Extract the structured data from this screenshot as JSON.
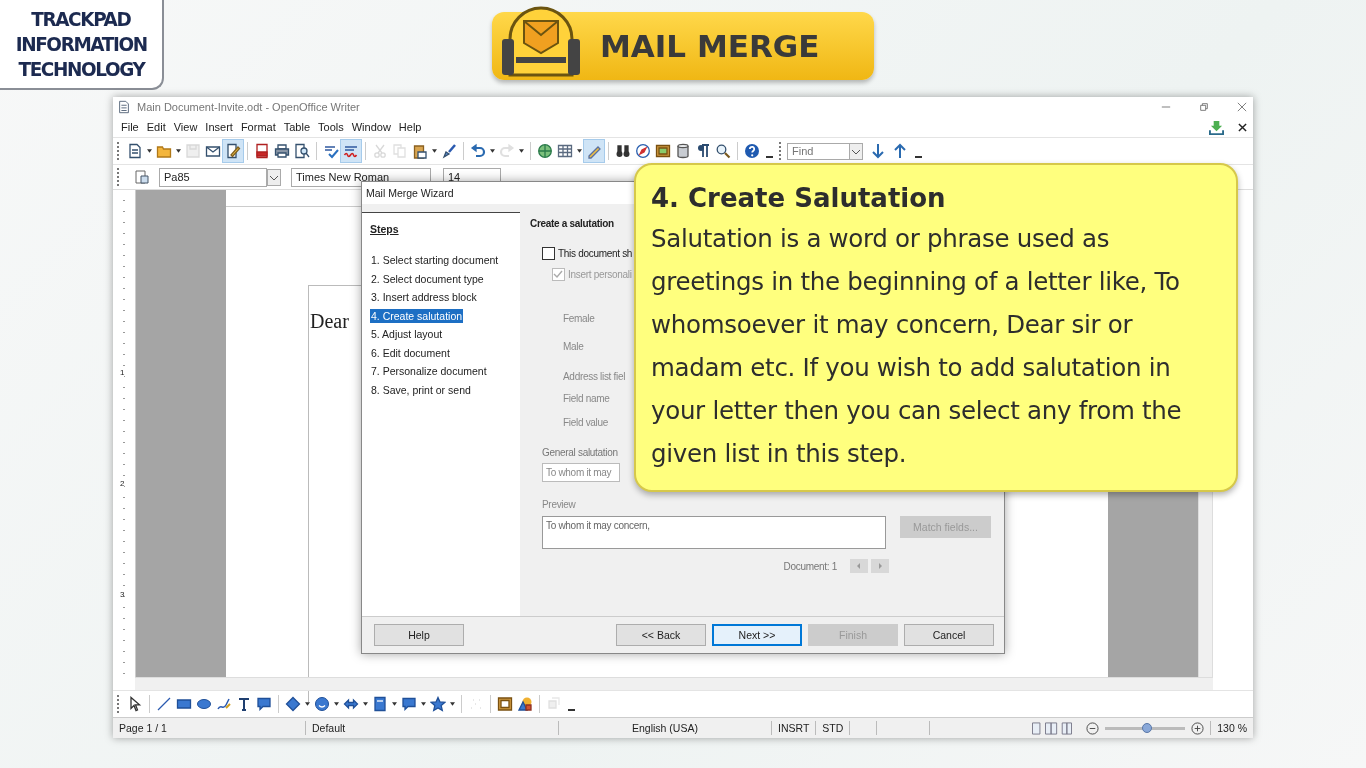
{
  "logo": {
    "lines": [
      "TRACKPAD",
      "INFORMATION",
      "TECHNOLOGY"
    ]
  },
  "banner": {
    "title": "MAIL MERGE"
  },
  "window": {
    "title": "Main Document-Invite.odt - OpenOffice Writer"
  },
  "menu": [
    "File",
    "Edit",
    "View",
    "Insert",
    "Format",
    "Table",
    "Tools",
    "Window",
    "Help"
  ],
  "standard_toolbar": [
    {
      "kind": "new",
      "menu": true,
      "pressed": false,
      "disabled": false
    },
    {
      "kind": "open",
      "menu": true,
      "pressed": false,
      "disabled": false
    },
    {
      "kind": "save",
      "menu": false,
      "pressed": false,
      "disabled": true
    },
    {
      "kind": "email",
      "menu": false,
      "pressed": false,
      "disabled": false
    },
    {
      "kind": "edit",
      "menu": false,
      "pressed": true,
      "disabled": false
    },
    {
      "kind": "separator"
    },
    {
      "kind": "pdf",
      "menu": false,
      "pressed": false,
      "disabled": false
    },
    {
      "kind": "print",
      "menu": false,
      "pressed": false,
      "disabled": false
    },
    {
      "kind": "preview",
      "menu": false,
      "pressed": false,
      "disabled": false
    },
    {
      "kind": "separator"
    },
    {
      "kind": "spellcheck",
      "menu": false,
      "pressed": false,
      "disabled": false
    },
    {
      "kind": "autospell",
      "menu": false,
      "pressed": true,
      "disabled": false
    },
    {
      "kind": "separator"
    },
    {
      "kind": "cut",
      "menu": false,
      "pressed": false,
      "disabled": true
    },
    {
      "kind": "copy",
      "menu": false,
      "pressed": false,
      "disabled": true
    },
    {
      "kind": "paste",
      "menu": true,
      "pressed": false,
      "disabled": false
    },
    {
      "kind": "brush",
      "menu": false,
      "pressed": false,
      "disabled": false
    },
    {
      "kind": "separator"
    },
    {
      "kind": "undo",
      "menu": true,
      "pressed": false,
      "disabled": false
    },
    {
      "kind": "redo",
      "menu": true,
      "pressed": false,
      "disabled": true
    },
    {
      "kind": "separator"
    },
    {
      "kind": "globe",
      "menu": false,
      "pressed": false,
      "disabled": false
    },
    {
      "kind": "table",
      "menu": true,
      "pressed": false,
      "disabled": false
    },
    {
      "kind": "draw",
      "menu": false,
      "pressed": true,
      "disabled": false
    },
    {
      "kind": "separator"
    },
    {
      "kind": "binoculars",
      "menu": false,
      "pressed": false,
      "disabled": false
    },
    {
      "kind": "compass",
      "menu": false,
      "pressed": false,
      "disabled": false
    },
    {
      "kind": "gallery",
      "menu": false,
      "pressed": false,
      "disabled": false
    },
    {
      "kind": "database",
      "menu": false,
      "pressed": false,
      "disabled": false
    },
    {
      "kind": "pilcrow",
      "menu": false,
      "pressed": false,
      "disabled": false
    },
    {
      "kind": "zoom",
      "menu": false,
      "pressed": false,
      "disabled": false
    },
    {
      "kind": "separator"
    },
    {
      "kind": "help",
      "menu": false,
      "pressed": false,
      "disabled": false
    }
  ],
  "formatting_toolbar": {
    "style": "Pa85",
    "font": "Times New Roman",
    "size": "14"
  },
  "find_toolbar": {
    "placeholder": "Find"
  },
  "document": {
    "text": "Dear",
    "vertical_ruler": [
      "1",
      "2",
      "3"
    ]
  },
  "drawing_toolbar": [
    {
      "kind": "select",
      "menu": false,
      "disabled": false
    },
    {
      "kind": "separator"
    },
    {
      "kind": "line",
      "menu": false,
      "disabled": false
    },
    {
      "kind": "rectangle",
      "menu": false,
      "disabled": false
    },
    {
      "kind": "ellipse",
      "menu": false,
      "disabled": false
    },
    {
      "kind": "freeform",
      "menu": false,
      "disabled": false
    },
    {
      "kind": "text",
      "menu": false,
      "disabled": false
    },
    {
      "kind": "callout",
      "menu": false,
      "disabled": false
    },
    {
      "kind": "separator"
    },
    {
      "kind": "diamond",
      "menu": true,
      "disabled": false
    },
    {
      "kind": "smiley",
      "menu": true,
      "disabled": false
    },
    {
      "kind": "double-arrow",
      "menu": true,
      "disabled": false
    },
    {
      "kind": "flowchart",
      "menu": true,
      "disabled": false
    },
    {
      "kind": "callout",
      "menu": true,
      "disabled": false
    },
    {
      "kind": "star",
      "menu": true,
      "disabled": false
    },
    {
      "kind": "separator"
    },
    {
      "kind": "points",
      "menu": false,
      "disabled": true
    },
    {
      "kind": "separator"
    },
    {
      "kind": "frame",
      "menu": false,
      "disabled": false
    },
    {
      "kind": "shapes",
      "menu": false,
      "disabled": false
    },
    {
      "kind": "separator"
    },
    {
      "kind": "extrusion",
      "menu": false,
      "disabled": true
    }
  ],
  "status_bar": {
    "page": "Page 1 / 1",
    "style": "Default",
    "language": "English (USA)",
    "insert_mode": "INSRT",
    "selection_mode": "STD",
    "zoom_slider": {
      "level": 0.52
    },
    "zoom": "130 %"
  },
  "dialog": {
    "title": "Mail Merge Wizard",
    "steps_heading": "Steps",
    "steps": [
      {
        "label": "1. Select starting document",
        "selected": false
      },
      {
        "label": "2. Select document type",
        "selected": false
      },
      {
        "label": "3. Insert address block",
        "selected": false
      },
      {
        "label": "4. Create salutation",
        "selected": true
      },
      {
        "label": "5. Adjust layout",
        "selected": false
      },
      {
        "label": "6. Edit document",
        "selected": false
      },
      {
        "label": "7. Personalize document",
        "selected": false
      },
      {
        "label": "8. Save, print or send",
        "selected": false
      }
    ],
    "heading": "Create a salutation",
    "checkboxes": [
      {
        "label": "This document sh",
        "checked": false,
        "disabled": false
      },
      {
        "label": "Insert personali",
        "checked": true,
        "disabled": true
      }
    ],
    "labels": [
      "Female",
      "Male",
      "Address list fiel",
      "Field name",
      "Field value"
    ],
    "general_salutation": {
      "label": "General salutation",
      "value": "To whom it may"
    },
    "preview": {
      "label": "Preview",
      "text": "To whom it may concern,"
    },
    "match_fields": {
      "label": "Match fields...",
      "disabled": true
    },
    "document_counter": "Document: 1",
    "buttons": [
      {
        "label": "Help",
        "disabled": false,
        "focused": false
      },
      {
        "label": "<< Back",
        "disabled": false,
        "focused": false
      },
      {
        "label": "Next >>",
        "disabled": false,
        "focused": true
      },
      {
        "label": "Finish",
        "disabled": true,
        "focused": false
      },
      {
        "label": "Cancel",
        "disabled": false,
        "focused": false
      }
    ]
  },
  "callout": {
    "title": "4. Create Salutation",
    "body": "Salutation is a word or phrase used as greetings in the beginning of a letter like, To whomsoever it may concern, Dear sir or madam etc. If you wish to add salutation in your letter then you can select any from the given list in this step."
  }
}
